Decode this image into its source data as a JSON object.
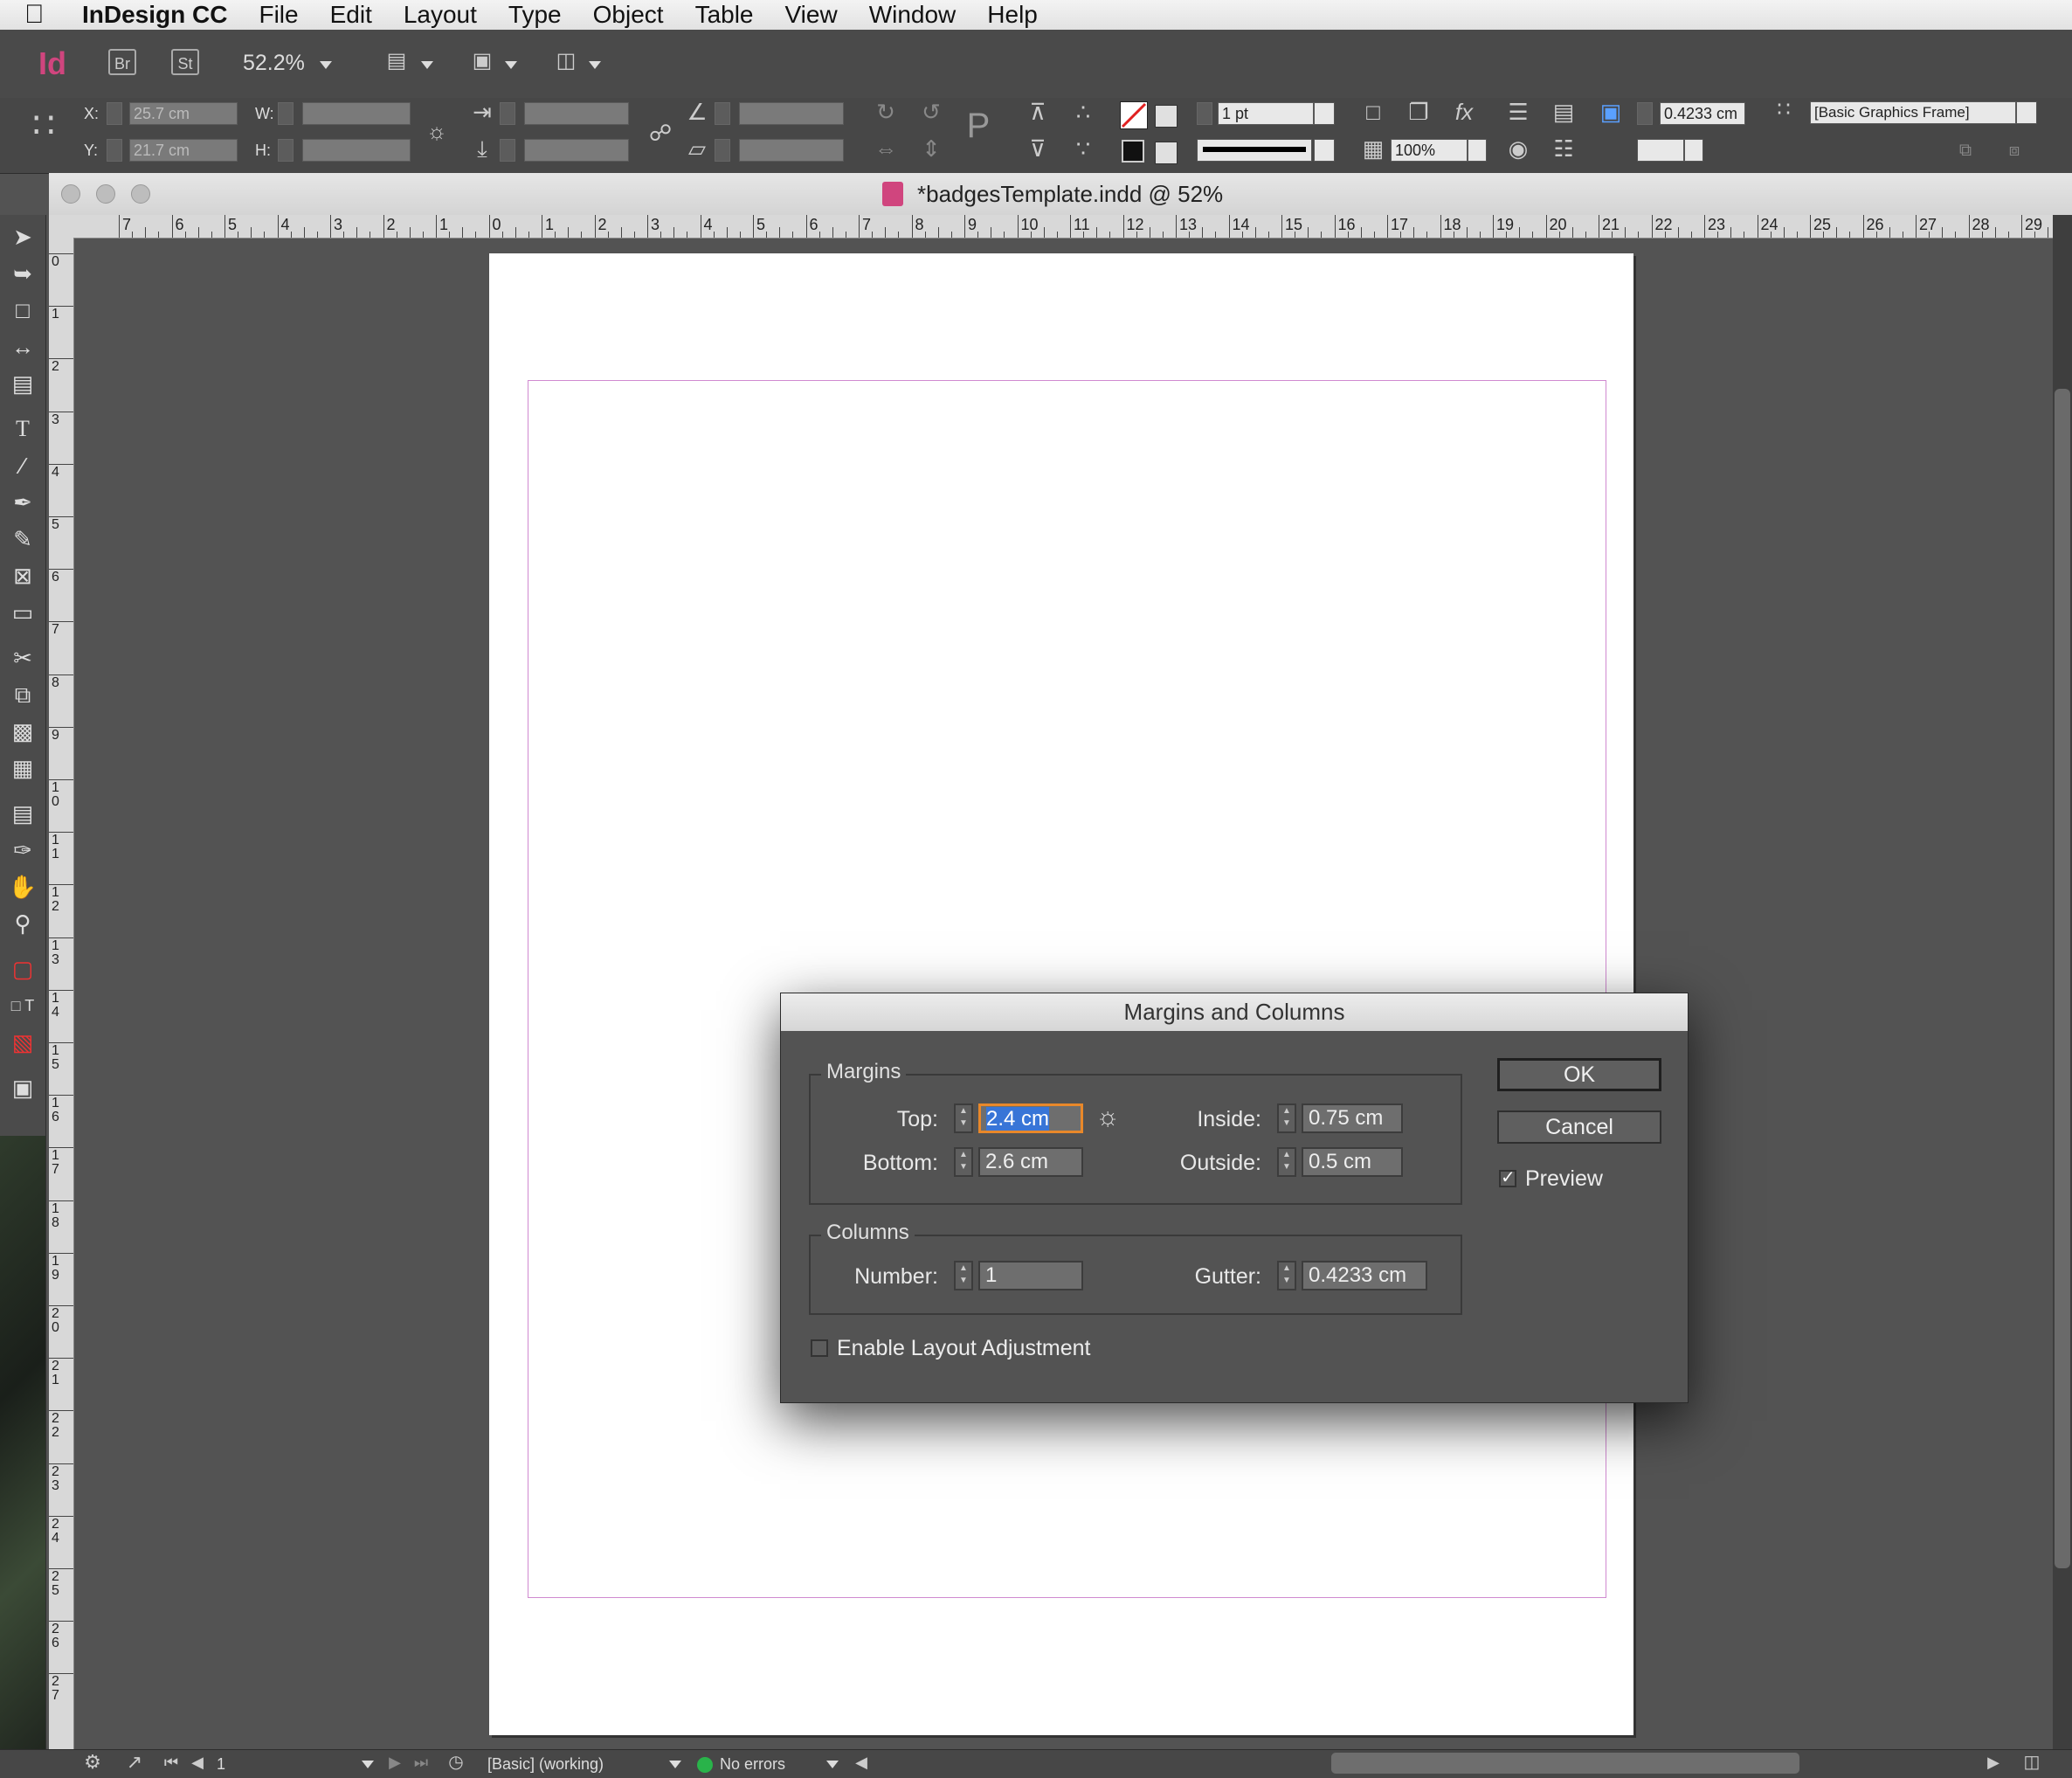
{
  "menubar": {
    "apple_icon": "apple-icon",
    "app": "InDesign CC",
    "items": [
      "File",
      "Edit",
      "Layout",
      "Type",
      "Object",
      "Table",
      "View",
      "Window",
      "Help"
    ]
  },
  "appbar": {
    "logo": "Id",
    "br": "Br",
    "st": "St",
    "zoom": "52.2%"
  },
  "control": {
    "x_label": "X:",
    "x_value": "25.7 cm",
    "y_label": "Y:",
    "y_value": "21.7 cm",
    "w_label": "W:",
    "h_label": "H:",
    "stroke_weight": "1 pt",
    "opacity": "100%",
    "gutter_value": "0.4233 cm",
    "object_style": "[Basic Graphics Frame]"
  },
  "document": {
    "title": "*badgesTemplate.indd @ 52%"
  },
  "ruler": {
    "h_labels": [
      "7",
      "6",
      "5",
      "4",
      "3",
      "2",
      "1",
      "0",
      "1",
      "2",
      "3",
      "4",
      "5",
      "6",
      "7",
      "8",
      "9",
      "10",
      "11",
      "12",
      "13",
      "14",
      "15",
      "16",
      "17",
      "18",
      "19",
      "20",
      "21",
      "22",
      "23",
      "24",
      "25",
      "26",
      "27",
      "28",
      "29"
    ],
    "v_labels": [
      "0",
      "1",
      "2",
      "3",
      "4",
      "5",
      "6",
      "7",
      "8",
      "9",
      "1\n0",
      "1\n1",
      "1\n2",
      "1\n3",
      "1\n4",
      "1\n5",
      "1\n6",
      "1\n7",
      "1\n8",
      "1\n9",
      "2\n0",
      "2\n1",
      "2\n2",
      "2\n3",
      "2\n4",
      "2\n5",
      "2\n6",
      "2\n7"
    ]
  },
  "dialog": {
    "title": "Margins and Columns",
    "margins_label": "Margins",
    "top_label": "Top:",
    "top_value": "2.4 cm",
    "bottom_label": "Bottom:",
    "bottom_value": "2.6 cm",
    "inside_label": "Inside:",
    "inside_value": "0.75 cm",
    "outside_label": "Outside:",
    "outside_value": "0.5 cm",
    "columns_label": "Columns",
    "number_label": "Number:",
    "number_value": "1",
    "gutter_label": "Gutter:",
    "gutter_value": "0.4233 cm",
    "layout_adjust_label": "Enable Layout Adjustment",
    "layout_adjust_checked": false,
    "ok_label": "OK",
    "cancel_label": "Cancel",
    "preview_label": "Preview",
    "preview_checked": true
  },
  "status": {
    "page_number": "1",
    "preflight_profile": "[Basic] (working)",
    "errors": "No errors",
    "error_color": "#29b34a"
  },
  "colors": {
    "accent_focus": "#e8882a",
    "selection": "#3875d7",
    "margin_guide": "#d08ad0",
    "brand": "#d0457e"
  }
}
